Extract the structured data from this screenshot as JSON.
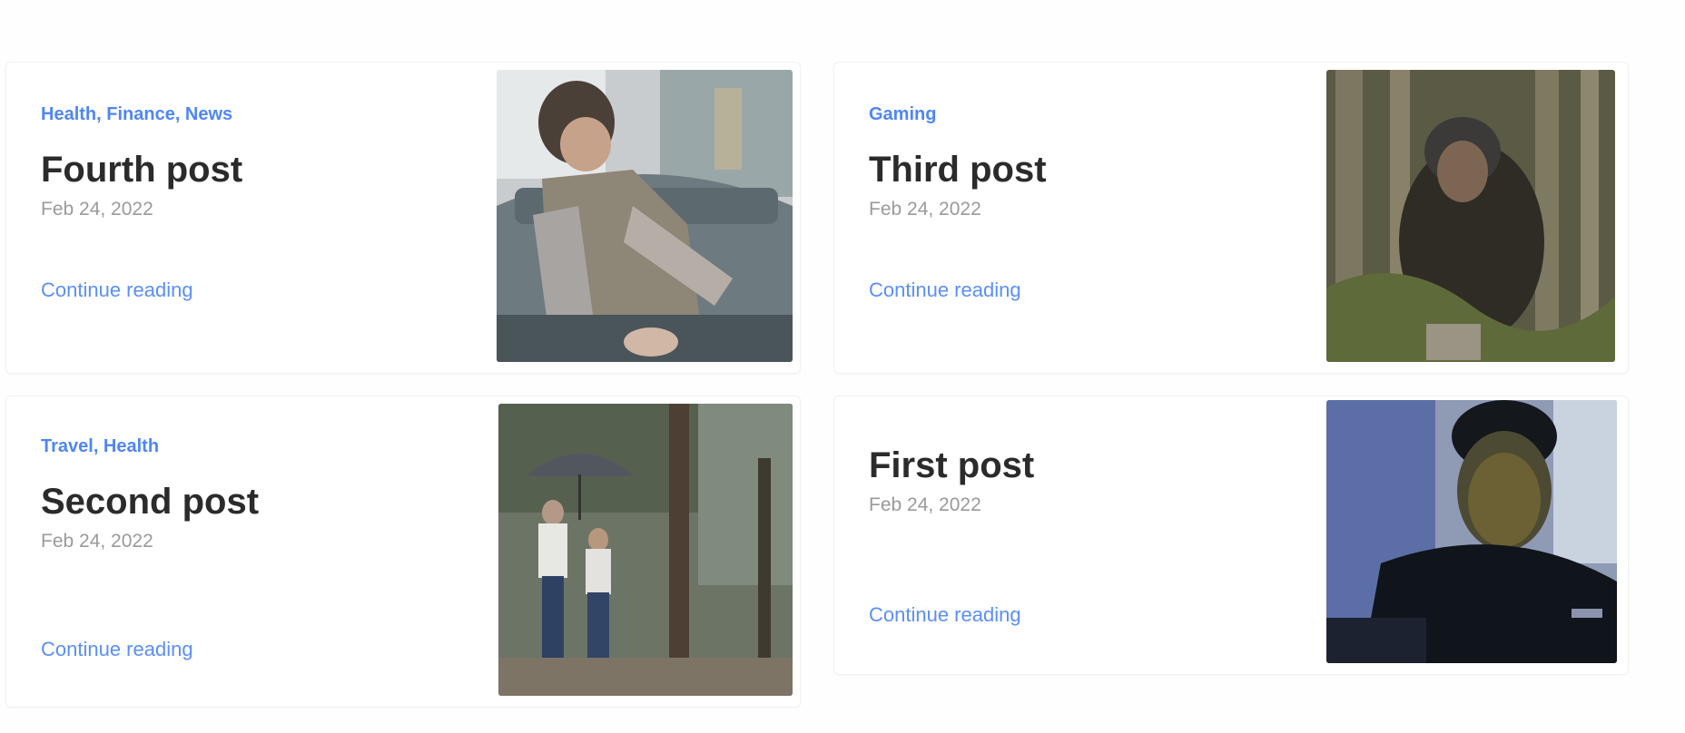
{
  "posts": [
    {
      "category": "Health, Finance, News",
      "title": "Fourth post",
      "date": "Feb 24, 2022",
      "link": "Continue reading",
      "image": "man-leaning-on-car-photo"
    },
    {
      "category": "Gaming",
      "title": "Third post",
      "date": "Feb 24, 2022",
      "link": "Continue reading",
      "image": "person-among-trees-photo"
    },
    {
      "category": "Travel, Health",
      "title": "Second post",
      "date": "Feb 24, 2022",
      "link": "Continue reading",
      "image": "people-with-umbrella-photo"
    },
    {
      "category": "",
      "title": "First post",
      "date": "Feb 24, 2022",
      "link": "Continue reading",
      "image": "man-portrait-photo"
    }
  ],
  "colors": {
    "accent": "#4f86f7",
    "title": "#2b2b2b",
    "muted": "#9a9a9a",
    "background": "#fefefe"
  }
}
